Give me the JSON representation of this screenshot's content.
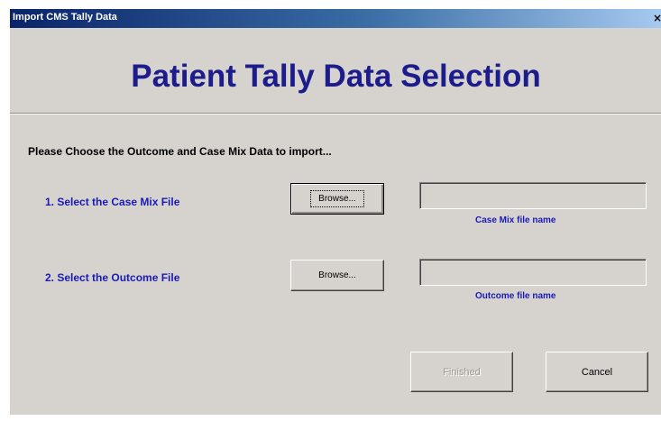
{
  "window": {
    "title": "Import CMS Tally Data",
    "close_glyph": "×"
  },
  "header": {
    "title": "Patient Tally Data Selection"
  },
  "instructions": "Please Choose the Outcome and Case Mix Data to import...",
  "steps": [
    {
      "label": "1.  Select the Case Mix File",
      "browse_label": "Browse...",
      "field_value": "",
      "field_caption": "Case Mix file name"
    },
    {
      "label": "2.  Select the Outcome File",
      "browse_label": "Browse...",
      "field_value": "",
      "field_caption": "Outcome file name"
    }
  ],
  "buttons": {
    "finished_label": "Finished",
    "cancel_label": "Cancel"
  },
  "colors": {
    "title_bar": "#0a246a",
    "heading": "#1c1c8c",
    "step_text": "#1a1ab8",
    "dialog_face": "#d6d3ce"
  },
  "icons": {
    "close": "close-icon"
  }
}
